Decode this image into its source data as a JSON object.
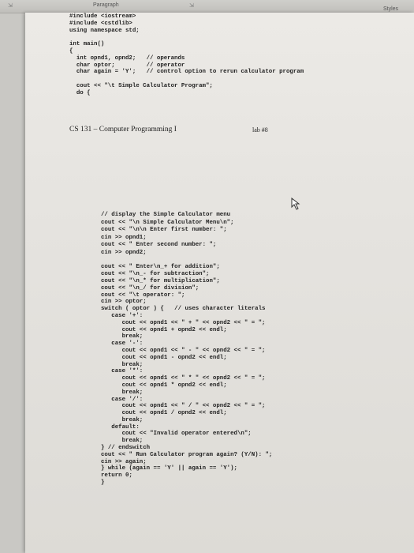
{
  "ribbon": {
    "paragraph_label": "Paragraph",
    "styles_label": "Styles"
  },
  "code_top": [
    "#include <iostream>",
    "#include <cstdlib>",
    "using namespace std;",
    "",
    "int main()",
    "{",
    "  int opnd1, opnd2;   // operands",
    "  char optor;         // operator",
    "  char again = 'Y';   // control option to rerun calculator program",
    "",
    "  cout << \"\\t Simple Calculator Program\";",
    "  do {"
  ],
  "header": {
    "course": "CS 131 – Computer Programming I",
    "lab": "lab #8"
  },
  "code_bottom": [
    "// display the Simple Calculator menu",
    "cout << \"\\n Simple Calculator Menu\\n\";",
    "cout << \"\\n\\n Enter first number: \";",
    "cin >> opnd1;",
    "cout << \" Enter second number: \";",
    "cin >> opnd2;",
    "",
    "cout << \" Enter\\n_+ for addition\";",
    "cout << \"\\n_- for subtraction\";",
    "cout << \"\\n_* for multiplication\";",
    "cout << \"\\n_/ for division\";",
    "cout << \"\\t operator: \";",
    "cin >> optor;",
    "switch ( optor ) {   // uses character literals",
    "   case '+':",
    "      cout << opnd1 << \" + \" << opnd2 << \" = \";",
    "      cout << opnd1 + opnd2 << endl;",
    "      break;",
    "   case '-':",
    "      cout << opnd1 << \" - \" << opnd2 << \" = \";",
    "      cout << opnd1 - opnd2 << endl;",
    "      break;",
    "   case '*':",
    "      cout << opnd1 << \" * \" << opnd2 << \" = \";",
    "      cout << opnd1 * opnd2 << endl;",
    "      break;",
    "   case '/':",
    "      cout << opnd1 << \" / \" << opnd2 << \" = \";",
    "      cout << opnd1 / opnd2 << endl;",
    "      break;",
    "   default:",
    "      cout << \"Invalid operator entered\\n\";",
    "      break;",
    "} // endswitch",
    "cout << \" Run Calculator program again? (Y/N): \";",
    "cin >> again;",
    "} while (again == 'Y' || again == 'Y');",
    "return 0;",
    "}"
  ]
}
